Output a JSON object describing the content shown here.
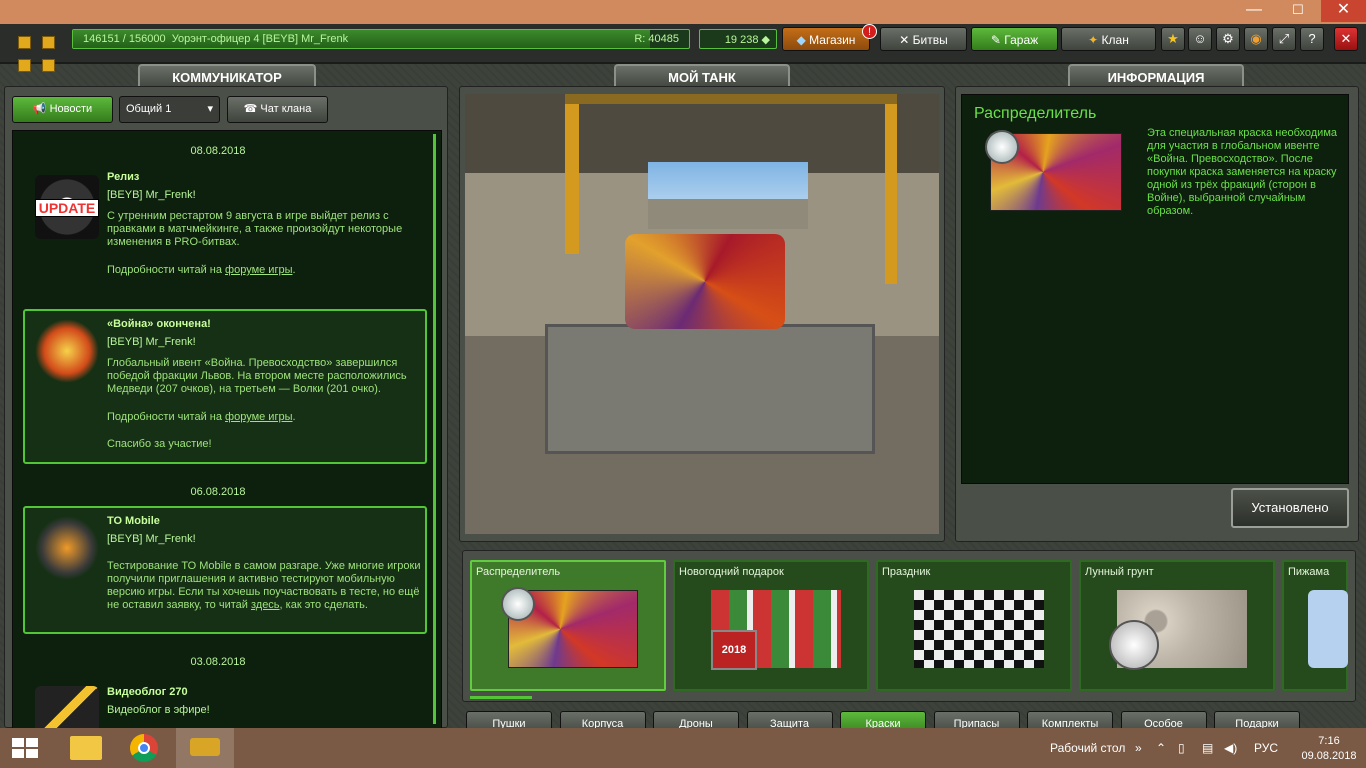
{
  "window": {
    "minimize_icon": "minimize-icon",
    "maximize_icon": "maximize-icon",
    "close_icon": "close-icon"
  },
  "topbar": {
    "experience": "146151 / 156000",
    "rank_user": "Уорэнт-офицер 4 [BEYB] Mr_Frenk",
    "rating": "R: 40485",
    "xp_progress": 0.937,
    "crystals": "19 238",
    "nav": {
      "shop": "Магазин",
      "shop_badge": "!",
      "battles": "Битвы",
      "garage": "Гараж",
      "clan": "Клан"
    }
  },
  "communicator": {
    "tab": "КОММУНИКАТОР",
    "buttons": {
      "news": "Новости",
      "channel": "Общий 1",
      "clan_chat": "Чат клана"
    },
    "news": [
      {
        "date": "08.08.2018",
        "title": "Релиз",
        "user": "[BEYB] Mr_Frenk!",
        "text": "С утренним рестартом 9 августа в игре выйдет релиз с правками в матчмейкинге, а также произойдут некоторые изменения в PRO-битвах.",
        "more_prefix": "Подробности читай на ",
        "more_link": "форуме игры",
        "more_suffix": ".",
        "icon_label": "UPDATE"
      },
      {
        "title": "«Война» окончена!",
        "user": "[BEYB] Mr_Frenk!",
        "text": "Глобальный ивент «Война. Превосходство» завершился победой фракции Львов. На втором месте расположились Медведи (207 очков), на третьем — Волки (201 очко).",
        "more_prefix": "Подробности читай на ",
        "more_link": "форуме игры",
        "more_suffix": ".",
        "thanks": "Спасибо за участие!"
      },
      {
        "date": "06.08.2018",
        "title": "ТО Mobile",
        "user": "[BEYB] Mr_Frenk!",
        "text_prefix": "Тестирование ТО Mobile в самом разгаре. Уже многие игроки получили приглашения и активно тестируют мобильную версию игры. Если ты хочешь поучаствовать в тесте, но ещё не оставил заявку, то читай ",
        "text_link": "здесь",
        "text_suffix": ", как это сделать."
      },
      {
        "date": "03.08.2018",
        "title": "Видеоблог 270",
        "user": "Видеоблог в эфире!"
      }
    ]
  },
  "tank": {
    "tab": "МОЙ ТАНК"
  },
  "info": {
    "tab": "ИНФОРМАЦИЯ",
    "title": "Распределитель",
    "description": "Эта специальная краска необходима для участия в глобальном ивенте «Война. Превосходство». После покупки краска заменяется на краску одной из трёх фракций (сторон в Войне), выбранной случайным образом.",
    "status": "Установлено"
  },
  "garage_items": [
    {
      "label": "Распределитель"
    },
    {
      "label": "Новогодний подарок",
      "year": "2018"
    },
    {
      "label": "Праздник"
    },
    {
      "label": "Лунный грунт"
    },
    {
      "label": "Пижама"
    }
  ],
  "categories": [
    "Пушки",
    "Корпуса",
    "Дроны",
    "Защита",
    "Краски",
    "Припасы",
    "Комплекты",
    "Особое",
    "Подарки"
  ],
  "active_category": "Краски",
  "taskbar": {
    "desktop_label": "Рабочий стол",
    "language": "РУС",
    "time": "7:16",
    "date": "09.08.2018"
  }
}
